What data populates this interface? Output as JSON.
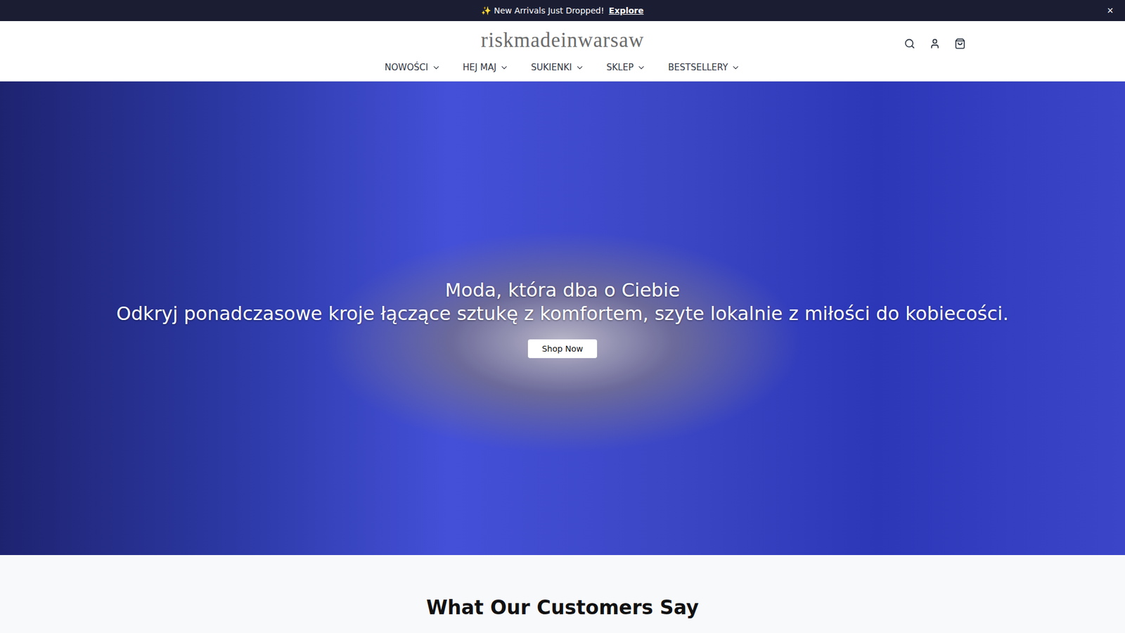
{
  "announcement": {
    "text": "✨ New Arrivals Just Dropped!",
    "link": "Explore",
    "close": "×"
  },
  "logo": "riskmadeinwarsaw",
  "nav": [
    {
      "label": "NOWOŚCI"
    },
    {
      "label": "HEJ MAJ"
    },
    {
      "label": "SUKIENKI"
    },
    {
      "label": "SKLEP"
    },
    {
      "label": "BESTSELLERY"
    }
  ],
  "hero": {
    "title": "Moda, która dba o Ciebie",
    "subtitle": "Odkryj ponadczasowe kroje łączące sztukę z komfortem, szyte lokalnie z miłości do kobiecości.",
    "button": "Shop Now"
  },
  "testimonials": {
    "heading": "What Our Customers Say"
  }
}
